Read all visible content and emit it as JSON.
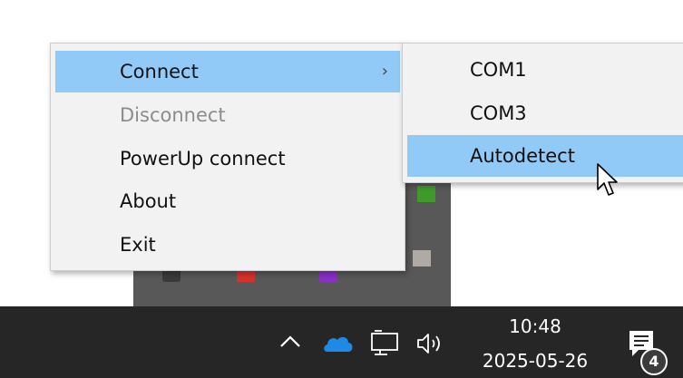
{
  "context_menu": {
    "items": [
      {
        "label": "Connect",
        "has_submenu": true,
        "selected": true,
        "enabled": true
      },
      {
        "label": "Disconnect",
        "enabled": false
      },
      {
        "label": "PowerUp connect",
        "enabled": true
      },
      {
        "label": "About",
        "enabled": true
      },
      {
        "label": "Exit",
        "enabled": true
      }
    ],
    "submenu_arrow": "›"
  },
  "submenu": {
    "items": [
      {
        "label": "COM1"
      },
      {
        "label": "COM3"
      },
      {
        "label": "Autodetect",
        "selected": true
      }
    ]
  },
  "taskbar": {
    "time": "10:48",
    "date": "2025-05-26",
    "notification_count": "4",
    "icons": [
      "chevron-up-icon",
      "onedrive-cloud-icon",
      "network-icon",
      "speaker-icon",
      "notification-center-icon"
    ]
  },
  "colors": {
    "menu_background": "#f2f2f2",
    "selection_highlight": "#91c9f7",
    "disabled_text": "#8c8c8c",
    "taskbar_background": "#262626",
    "cloud_icon": "#1e8ae6"
  }
}
